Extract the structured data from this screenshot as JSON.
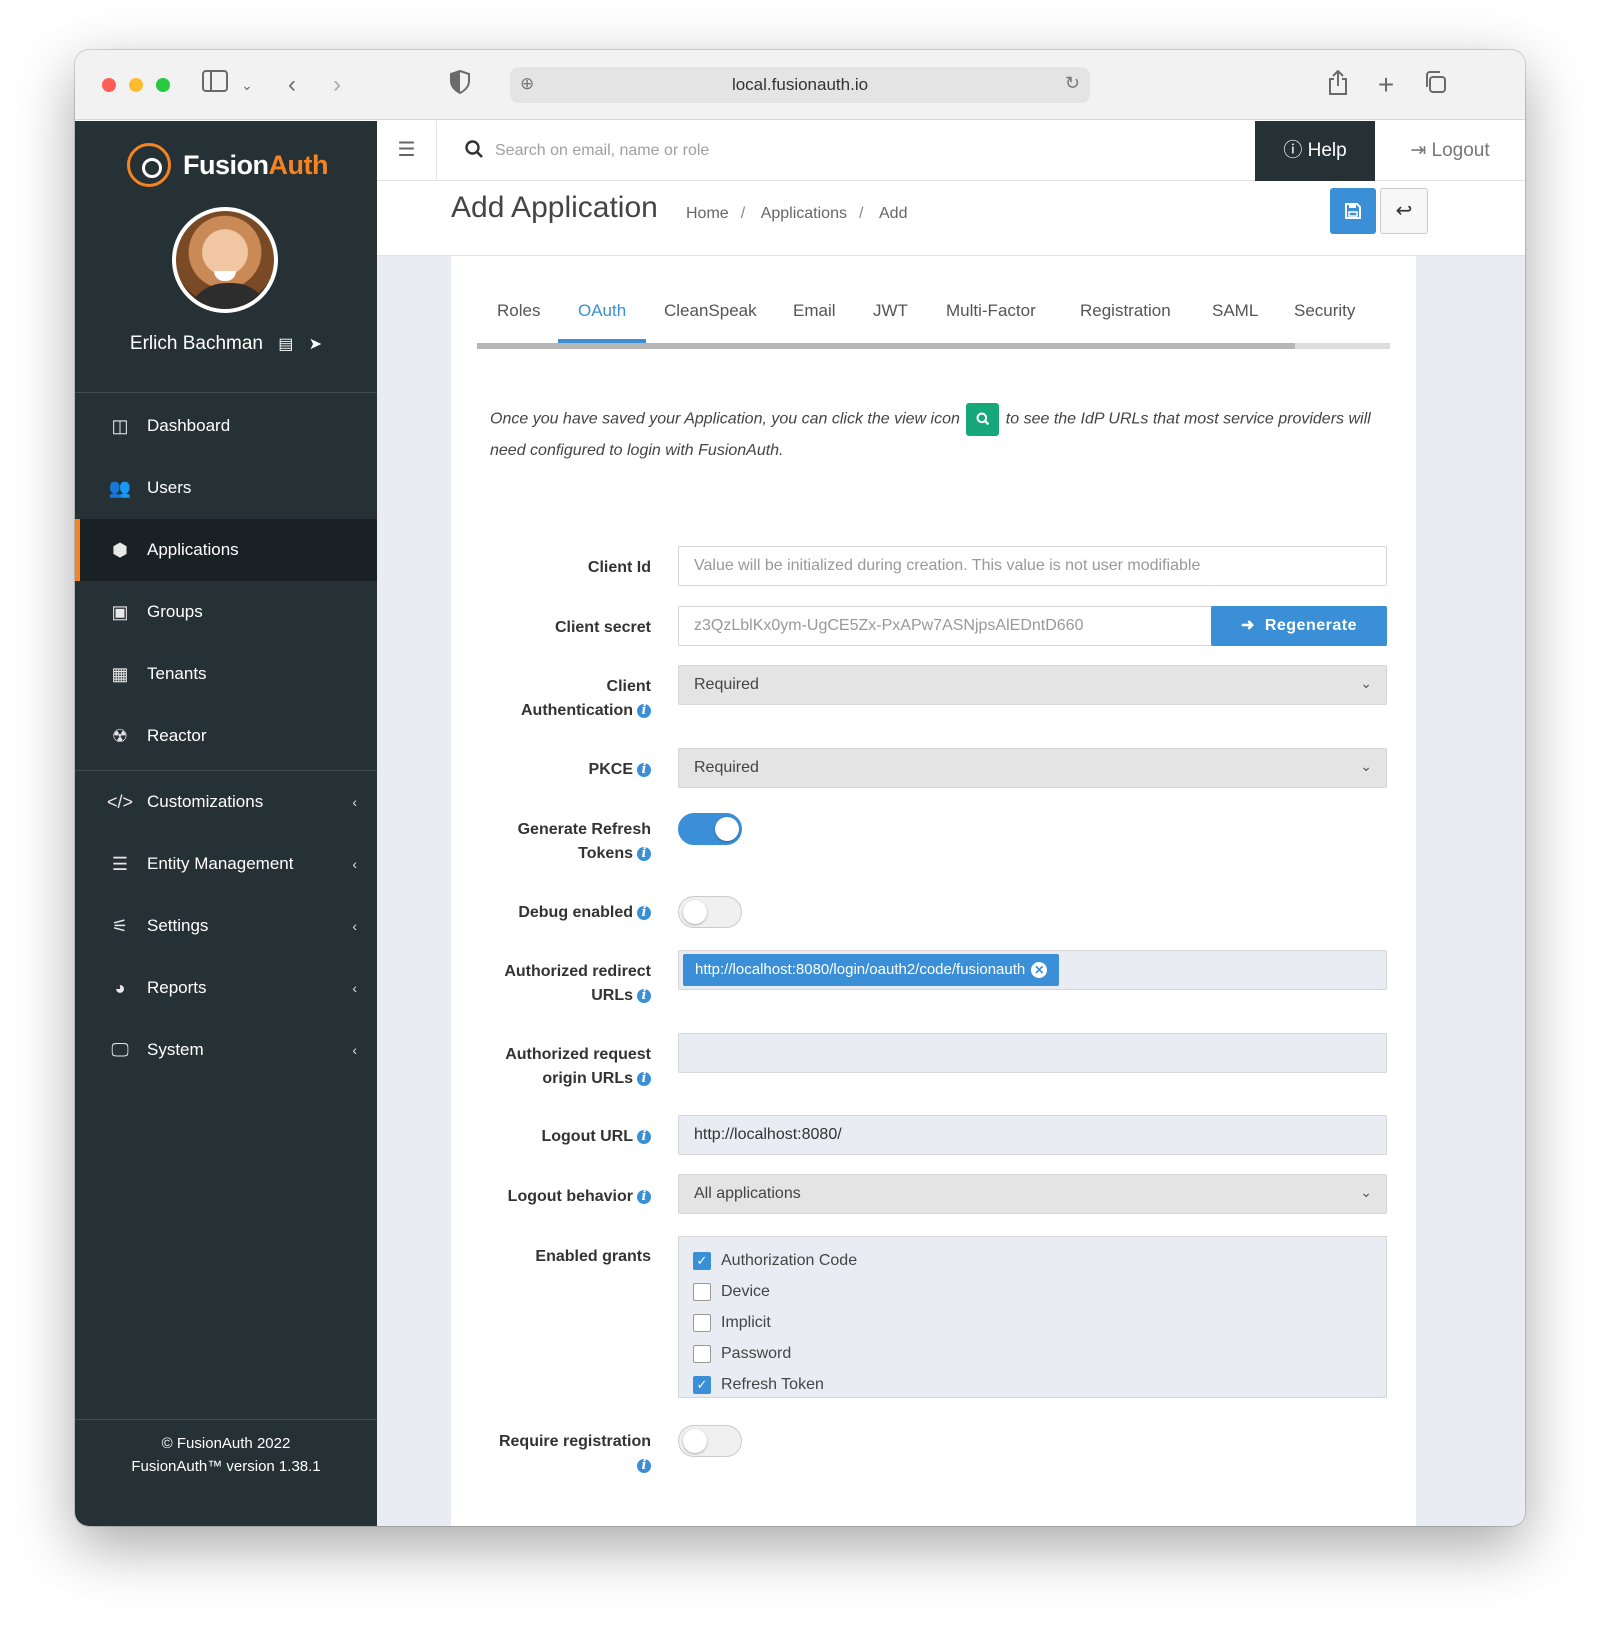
{
  "browser": {
    "url": "local.fusionauth.io"
  },
  "brand": {
    "name_part1": "Fusion",
    "name_part2": "Auth"
  },
  "user": {
    "name": "Erlich Bachman"
  },
  "nav": {
    "items": [
      {
        "label": "Dashboard",
        "icon": "dashboard-icon"
      },
      {
        "label": "Users",
        "icon": "users-icon"
      },
      {
        "label": "Applications",
        "icon": "cube-icon",
        "active": true
      },
      {
        "label": "Groups",
        "icon": "groups-icon"
      },
      {
        "label": "Tenants",
        "icon": "building-icon"
      },
      {
        "label": "Reactor",
        "icon": "radiation-icon"
      },
      {
        "label": "Customizations",
        "icon": "code-icon"
      },
      {
        "label": "Entity Management",
        "icon": "server-icon"
      },
      {
        "label": "Settings",
        "icon": "sliders-icon"
      },
      {
        "label": "Reports",
        "icon": "pie-chart-icon"
      },
      {
        "label": "System",
        "icon": "desktop-icon"
      }
    ]
  },
  "footer": {
    "copyright": "© FusionAuth 2022",
    "version": "FusionAuth™ version 1.38.1"
  },
  "topbar": {
    "search_placeholder": "Search on email, name or role",
    "help": "Help",
    "logout": "Logout"
  },
  "header": {
    "title": "Add Application",
    "breadcrumb": [
      "Home",
      "Applications",
      "Add"
    ]
  },
  "tabs": [
    "Roles",
    "OAuth",
    "CleanSpeak",
    "Email",
    "JWT",
    "Multi-Factor",
    "Registration",
    "SAML",
    "Security"
  ],
  "active_tab": "OAuth",
  "info": {
    "before_icon": "Once you have saved your Application, you can click the view icon",
    "after_icon": "to see the IdP URLs that most service providers will need configured to login with FusionAuth."
  },
  "form": {
    "client_id": {
      "label": "Client Id",
      "placeholder": "Value will be initialized during creation. This value is not user modifiable"
    },
    "client_secret": {
      "label": "Client secret",
      "value": "z3QzLblKx0ym-UgCE5Zx-PxAPw7ASNjpsAlEDntD660",
      "button": "Regenerate"
    },
    "client_auth": {
      "label_line1": "Client",
      "label_line2": "Authentication",
      "value": "Required"
    },
    "pkce": {
      "label": "PKCE",
      "value": "Required"
    },
    "refresh_tokens": {
      "label_line1": "Generate Refresh",
      "label_line2": "Tokens",
      "enabled": true
    },
    "debug": {
      "label": "Debug enabled",
      "enabled": false
    },
    "redirect_urls": {
      "label_line1": "Authorized redirect",
      "label_line2": "URLs",
      "chips": [
        "http://localhost:8080/login/oauth2/code/fusionauth"
      ]
    },
    "origin_urls": {
      "label_line1": "Authorized request",
      "label_line2": "origin URLs"
    },
    "logout_url": {
      "label": "Logout URL",
      "value": "http://localhost:8080/"
    },
    "logout_behavior": {
      "label": "Logout behavior",
      "value": "All applications"
    },
    "grants": {
      "label": "Enabled grants",
      "options": [
        {
          "label": "Authorization Code",
          "checked": true
        },
        {
          "label": "Device",
          "checked": false
        },
        {
          "label": "Implicit",
          "checked": false
        },
        {
          "label": "Password",
          "checked": false
        },
        {
          "label": "Refresh Token",
          "checked": true
        }
      ]
    },
    "require_registration": {
      "label": "Require registration",
      "enabled": false
    }
  }
}
